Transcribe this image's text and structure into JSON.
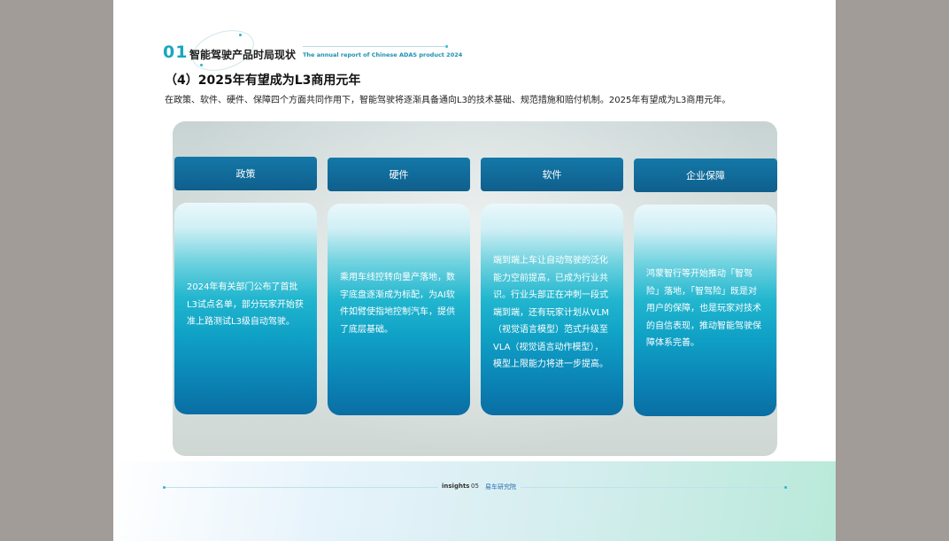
{
  "section": {
    "number": "01",
    "title": "智能驾驶产品时局现状",
    "subtitle": "The annual report of Chinese ADAS product 2024"
  },
  "heading": "（4）2025年有望成为L3商用元年",
  "intro": "在政策、软件、硬件、保障四个方面共同作用下，智能驾驶将逐渐具备通向L3的技术基础、规范措施和赔付机制。2025年有望成为L3商用元年。",
  "columns": [
    {
      "header": "政策",
      "body": "2024年有关部门公布了首批L3试点名单，部分玩家开始获准上路测试L3级自动驾驶。"
    },
    {
      "header": "硬件",
      "body": "乘用车线控转向量产落地，数字底盘逐渐成为标配，为AI软件如臂使指地控制汽车，提供了底层基础。"
    },
    {
      "header": "软件",
      "body": "端到端上车让自动驾驶的泛化能力空前提高，已成为行业共识。行业头部正在冲刺一段式端到端，还有玩家计划从VLM（视觉语言模型）范式升级至VLA（视觉语言动作模型），模型上限能力将进一步提高。"
    },
    {
      "header": "企业保障",
      "body": "鸿蒙智行等开始推动「智驾险」落地，「智驾险」既是对用户的保障，也是玩家对技术的自信表现，推动智能驾驶保障体系完善。"
    }
  ],
  "footer": {
    "brand": "insights",
    "page": "05",
    "partner": "易车研究院"
  },
  "colors": {
    "accent": "#1aa6c0",
    "header_blue": "#1478a8",
    "card_teal": "#10a2c6"
  }
}
